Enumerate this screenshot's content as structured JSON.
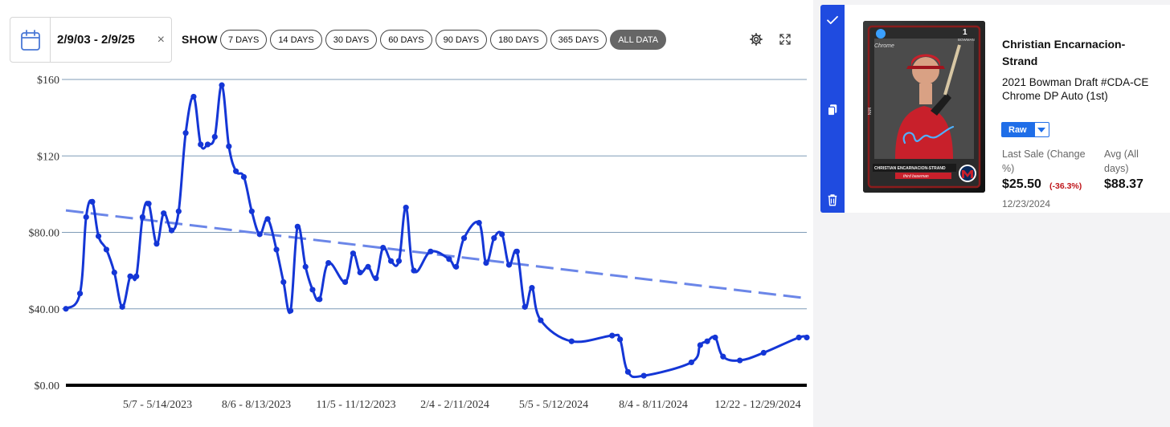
{
  "toolbar": {
    "date_range": "2/9/03 - 2/9/25",
    "clear_symbol": "×",
    "show_label": "SHOW",
    "ranges": [
      "7 DAYS",
      "14 DAYS",
      "30 DAYS",
      "60 DAYS",
      "90 DAYS",
      "180 DAYS",
      "365 DAYS",
      "ALL DATA"
    ],
    "active_range": "ALL DATA",
    "icons": [
      "calendar-icon",
      "gear-icon",
      "expand-icon"
    ]
  },
  "chart_data": {
    "type": "line",
    "title": "",
    "xlabel": "",
    "ylabel": "",
    "ylim": [
      0,
      160
    ],
    "y_ticks": [
      "$0.00",
      "$40.00",
      "$80.00",
      "$120",
      "$160"
    ],
    "y_tick_values": [
      0,
      40,
      80,
      120,
      160
    ],
    "x_tick_labels": [
      "5/7 - 5/14/2023",
      "8/6 - 8/13/2023",
      "11/5 - 11/12/2023",
      "2/4 - 2/11/2024",
      "5/5 - 5/12/2024",
      "8/4 - 8/11/2024",
      "12/22 - 12/29/2024"
    ],
    "grid": true,
    "legend": "none",
    "series": [
      {
        "style": "solid-with-markers",
        "color": "#1436d6",
        "points": [
          [
            "2023-02-12",
            40
          ],
          [
            "2023-02-28",
            48
          ],
          [
            "2023-03-07",
            88
          ],
          [
            "2023-03-14",
            96
          ],
          [
            "2023-03-21",
            78
          ],
          [
            "2023-03-30",
            71
          ],
          [
            "2023-04-08",
            59
          ],
          [
            "2023-04-17",
            41
          ],
          [
            "2023-04-26",
            57
          ],
          [
            "2023-05-03",
            57
          ],
          [
            "2023-05-10",
            88
          ],
          [
            "2023-05-17",
            95
          ],
          [
            "2023-05-26",
            74
          ],
          [
            "2023-06-03",
            90
          ],
          [
            "2023-06-12",
            81
          ],
          [
            "2023-06-20",
            91
          ],
          [
            "2023-06-28",
            132
          ],
          [
            "2023-07-07",
            151
          ],
          [
            "2023-07-15",
            126
          ],
          [
            "2023-07-23",
            126
          ],
          [
            "2023-07-31",
            130
          ],
          [
            "2023-08-08",
            157
          ],
          [
            "2023-08-16",
            125
          ],
          [
            "2023-08-24",
            112
          ],
          [
            "2023-09-02",
            109
          ],
          [
            "2023-09-11",
            91
          ],
          [
            "2023-09-20",
            79
          ],
          [
            "2023-09-29",
            87
          ],
          [
            "2023-10-09",
            71
          ],
          [
            "2023-10-17",
            54
          ],
          [
            "2023-10-25",
            39
          ],
          [
            "2023-11-02",
            83
          ],
          [
            "2023-11-11",
            62
          ],
          [
            "2023-11-19",
            50
          ],
          [
            "2023-11-27",
            45
          ],
          [
            "2023-12-07",
            64
          ],
          [
            "2023-12-26",
            54
          ],
          [
            "2024-01-04",
            69
          ],
          [
            "2024-01-12",
            59
          ],
          [
            "2024-01-21",
            62
          ],
          [
            "2024-01-30",
            56
          ],
          [
            "2024-02-07",
            72
          ],
          [
            "2024-02-16",
            65
          ],
          [
            "2024-02-25",
            65
          ],
          [
            "2024-03-04",
            93
          ],
          [
            "2024-03-13",
            60
          ],
          [
            "2024-04-01",
            70
          ],
          [
            "2024-04-22",
            66
          ],
          [
            "2024-04-30",
            62
          ],
          [
            "2024-05-09",
            77
          ],
          [
            "2024-05-26",
            85
          ],
          [
            "2024-06-03",
            64
          ],
          [
            "2024-06-12",
            77
          ],
          [
            "2024-06-21",
            79
          ],
          [
            "2024-06-29",
            63
          ],
          [
            "2024-07-08",
            70
          ],
          [
            "2024-07-17",
            41
          ],
          [
            "2024-07-25",
            51
          ],
          [
            "2024-08-04",
            34
          ],
          [
            "2024-09-08",
            23
          ],
          [
            "2024-10-24",
            26
          ],
          [
            "2024-11-02",
            24
          ],
          [
            "2024-11-11",
            7
          ],
          [
            "2024-11-29",
            5
          ],
          [
            "2025-01-22",
            12
          ],
          [
            "2025-02-01",
            21
          ],
          [
            "2025-02-09",
            23
          ],
          [
            "2025-02-18",
            25
          ],
          [
            "2025-02-27",
            15
          ],
          [
            "2025-03-18",
            13
          ],
          [
            "2025-04-14",
            17
          ],
          [
            "2025-05-24",
            25
          ],
          [
            "2025-06-02",
            25
          ]
        ]
      },
      {
        "style": "dashed-trend",
        "color": "#6b86e8",
        "points": [
          [
            "2023-02-12",
            91.5
          ],
          [
            "2025-06-02",
            45.5
          ]
        ]
      }
    ]
  },
  "card": {
    "player": "Christian Encarnacion-Strand",
    "set_line1": "2021 Bowman Draft #CDA-CE",
    "set_line2": "Chrome DP Auto (1st)",
    "grade": "Raw",
    "last_sale_label": "Last Sale (Change %)",
    "last_sale_price": "$25.50",
    "change": "(-36.3%)",
    "avg_label": "Avg (All days)",
    "avg_price": "$88.37",
    "last_sale_date": "12/23/2024",
    "image": {
      "brand": "Chrome",
      "number": "1",
      "maker": "BOWMAN",
      "name_plate": "CHRISTIAN ENCARNACION-STRAND",
      "position": "third baseman",
      "team_abbr": "MIN"
    },
    "colors": {
      "accent": "#1f4be0",
      "raw_button": "#1f6ee8",
      "negative": "#c0161b"
    }
  }
}
